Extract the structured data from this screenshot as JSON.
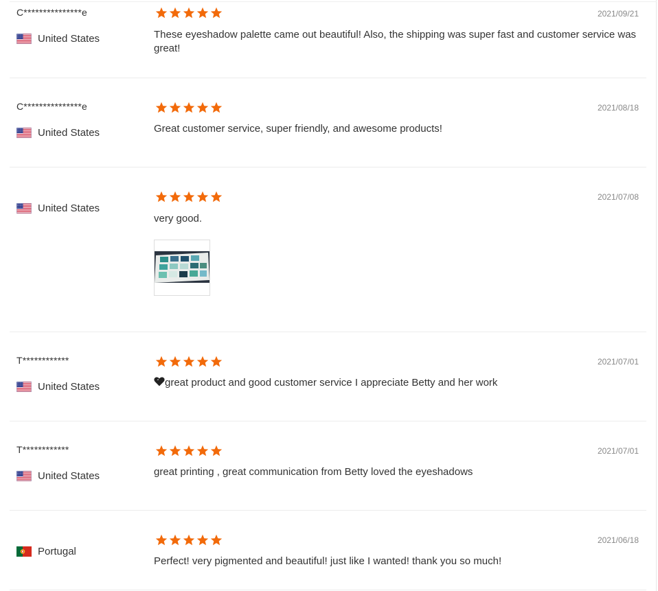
{
  "colors": {
    "star": "#f26a0a",
    "text": "#333333",
    "date": "#888888",
    "divider": "#ececec"
  },
  "reviews": [
    {
      "username": "C***************e",
      "country": "United States",
      "flag": "us-flag-icon",
      "rating": 5,
      "date": "2021/09/21",
      "text": "These eyeshadow palette came out beautiful! Also, the shipping was super fast and customer service was great!"
    },
    {
      "username": "C***************e",
      "country": "United States",
      "flag": "us-flag-icon",
      "rating": 5,
      "date": "2021/08/18",
      "text": "Great customer service, super friendly, and awesome products!"
    },
    {
      "username": "",
      "country": "United States",
      "flag": "us-flag-icon",
      "rating": 5,
      "date": "2021/07/08",
      "text": "very good.",
      "photo": "eyeshadow-palette-photo"
    },
    {
      "username": "T************",
      "country": "United States",
      "flag": "us-flag-icon",
      "rating": 5,
      "date": "2021/07/01",
      "text_icon": "heart-icon",
      "text": "great product and good customer service I appreciate Betty and her work"
    },
    {
      "username": "T************",
      "country": "United States",
      "flag": "us-flag-icon",
      "rating": 5,
      "date": "2021/07/01",
      "text": "great printing , great communication from Betty loved the eyeshadows"
    },
    {
      "username": "",
      "country": "Portugal",
      "flag": "portugal-flag-icon",
      "rating": 5,
      "date": "2021/06/18",
      "text": "Perfect! very pigmented and beautiful! just like I wanted! thank you so much!"
    }
  ]
}
